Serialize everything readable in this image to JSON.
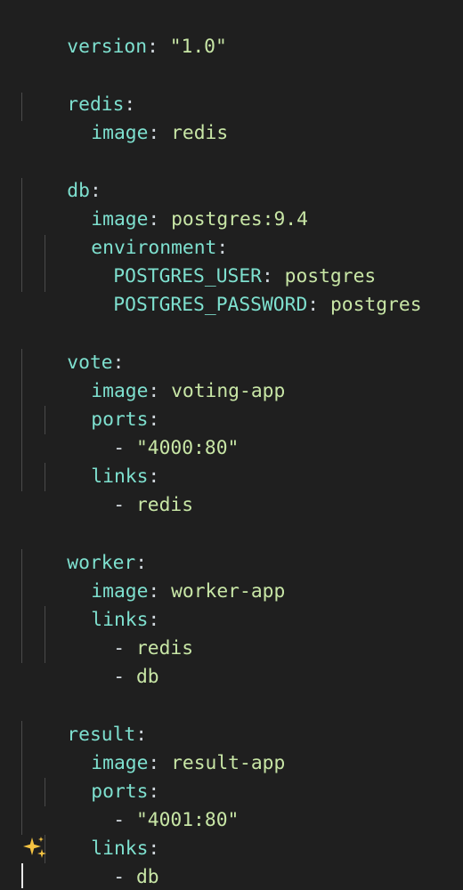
{
  "editor": {
    "lines": [
      {
        "key": "version",
        "value": "\"1.0\""
      },
      {
        "key": "redis"
      },
      {
        "key": "image",
        "value": "redis"
      },
      {
        "key": "db"
      },
      {
        "key": "image",
        "value": "postgres:9.4"
      },
      {
        "key": "environment"
      },
      {
        "key": "POSTGRES_USER",
        "value": "postgres"
      },
      {
        "key": "POSTGRES_PASSWORD",
        "value": "postgres"
      },
      {
        "key": "vote"
      },
      {
        "key": "image",
        "value": "voting-app"
      },
      {
        "key": "ports"
      },
      {
        "item": "\"4000:80\""
      },
      {
        "key": "links"
      },
      {
        "item": "redis"
      },
      {
        "key": "worker"
      },
      {
        "key": "image",
        "value": "worker-app"
      },
      {
        "key": "links"
      },
      {
        "item": "redis"
      },
      {
        "item": "db"
      },
      {
        "key": "result"
      },
      {
        "key": "image",
        "value": "result-app"
      },
      {
        "key": "ports"
      },
      {
        "item": "\"4001:80\""
      },
      {
        "key": "links"
      },
      {
        "item": "db"
      }
    ]
  },
  "icons": {
    "sparkle": "sparkle-icon"
  },
  "colors": {
    "background": "#1f1f1f",
    "key": "#7ee0cf",
    "string": "#c8e6a6",
    "indent_guide": "#4a4a4a",
    "sparkle": "#f5c342"
  }
}
